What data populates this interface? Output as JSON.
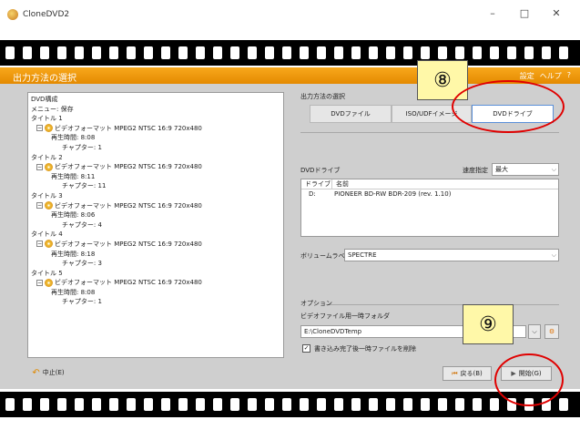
{
  "window": {
    "title": "CloneDVD2",
    "minimize_glyph": "–",
    "maximize_glyph": "□",
    "close_glyph": "✕"
  },
  "header": {
    "heading": "出力方法の選択",
    "links": [
      "設定",
      "ヘルプ",
      "?"
    ]
  },
  "tree": {
    "title": "DVD構成",
    "menu_line": "メニュー: 保存",
    "titles": [
      {
        "label": "タイトル 1",
        "video": "ビデオフォーマット MPEG2 NTSC 16:9 720x480",
        "duration": "再生時間: 8:08",
        "chapters": "チャプター: 1"
      },
      {
        "label": "タイトル 2",
        "video": "ビデオフォーマット MPEG2 NTSC 16:9 720x480",
        "duration": "再生時間: 8:11",
        "chapters": "チャプター: 11"
      },
      {
        "label": "タイトル 3",
        "video": "ビデオフォーマット MPEG2 NTSC 16:9 720x480",
        "duration": "再生時間: 8:06",
        "chapters": "チャプター: 4"
      },
      {
        "label": "タイトル 4",
        "video": "ビデオフォーマット MPEG2 NTSC 16:9 720x480",
        "duration": "再生時間: 8:18",
        "chapters": "チャプター: 3"
      },
      {
        "label": "タイトル 5",
        "video": "ビデオフォーマット MPEG2 NTSC 16:9 720x480",
        "duration": "再生時間: 8:08",
        "chapters": "チャプター: 1"
      }
    ]
  },
  "output": {
    "section_label": "出力方法の選択",
    "tabs": [
      "DVDファイル",
      "ISO/UDFイメージ",
      "DVDドライブ"
    ],
    "selected_tab": "DVDドライブ"
  },
  "drive": {
    "label": "DVDドライブ",
    "speed_label": "速度指定",
    "speed_value": "最大",
    "columns": [
      "ドライブ",
      "名前"
    ],
    "rows": [
      {
        "drive": "D:",
        "name": "PIONEER BD-RW   BDR-209 (rev. 1.10)"
      }
    ],
    "volume_label_caption": "ボリュームラベル",
    "volume_label_value": "SPECTRE"
  },
  "options": {
    "label": "オプション",
    "temp_folder_caption": "ビデオファイル用一時フォルダ",
    "temp_folder_value": "E:\\CloneDVDTemp",
    "delete_after_write_label": "書き込み完了後一時ファイルを削除",
    "delete_after_write_checked": true
  },
  "footer": {
    "cancel_label": "中止(E)",
    "back_label": "戻る(B)",
    "start_label": "開始(G)"
  },
  "annotations": {
    "callout_8": "⑧",
    "callout_9": "⑨"
  },
  "colors": {
    "header_orange": "#f29a0c",
    "annotation_red": "#e00000",
    "callout_yellow": "#fff8a8"
  }
}
